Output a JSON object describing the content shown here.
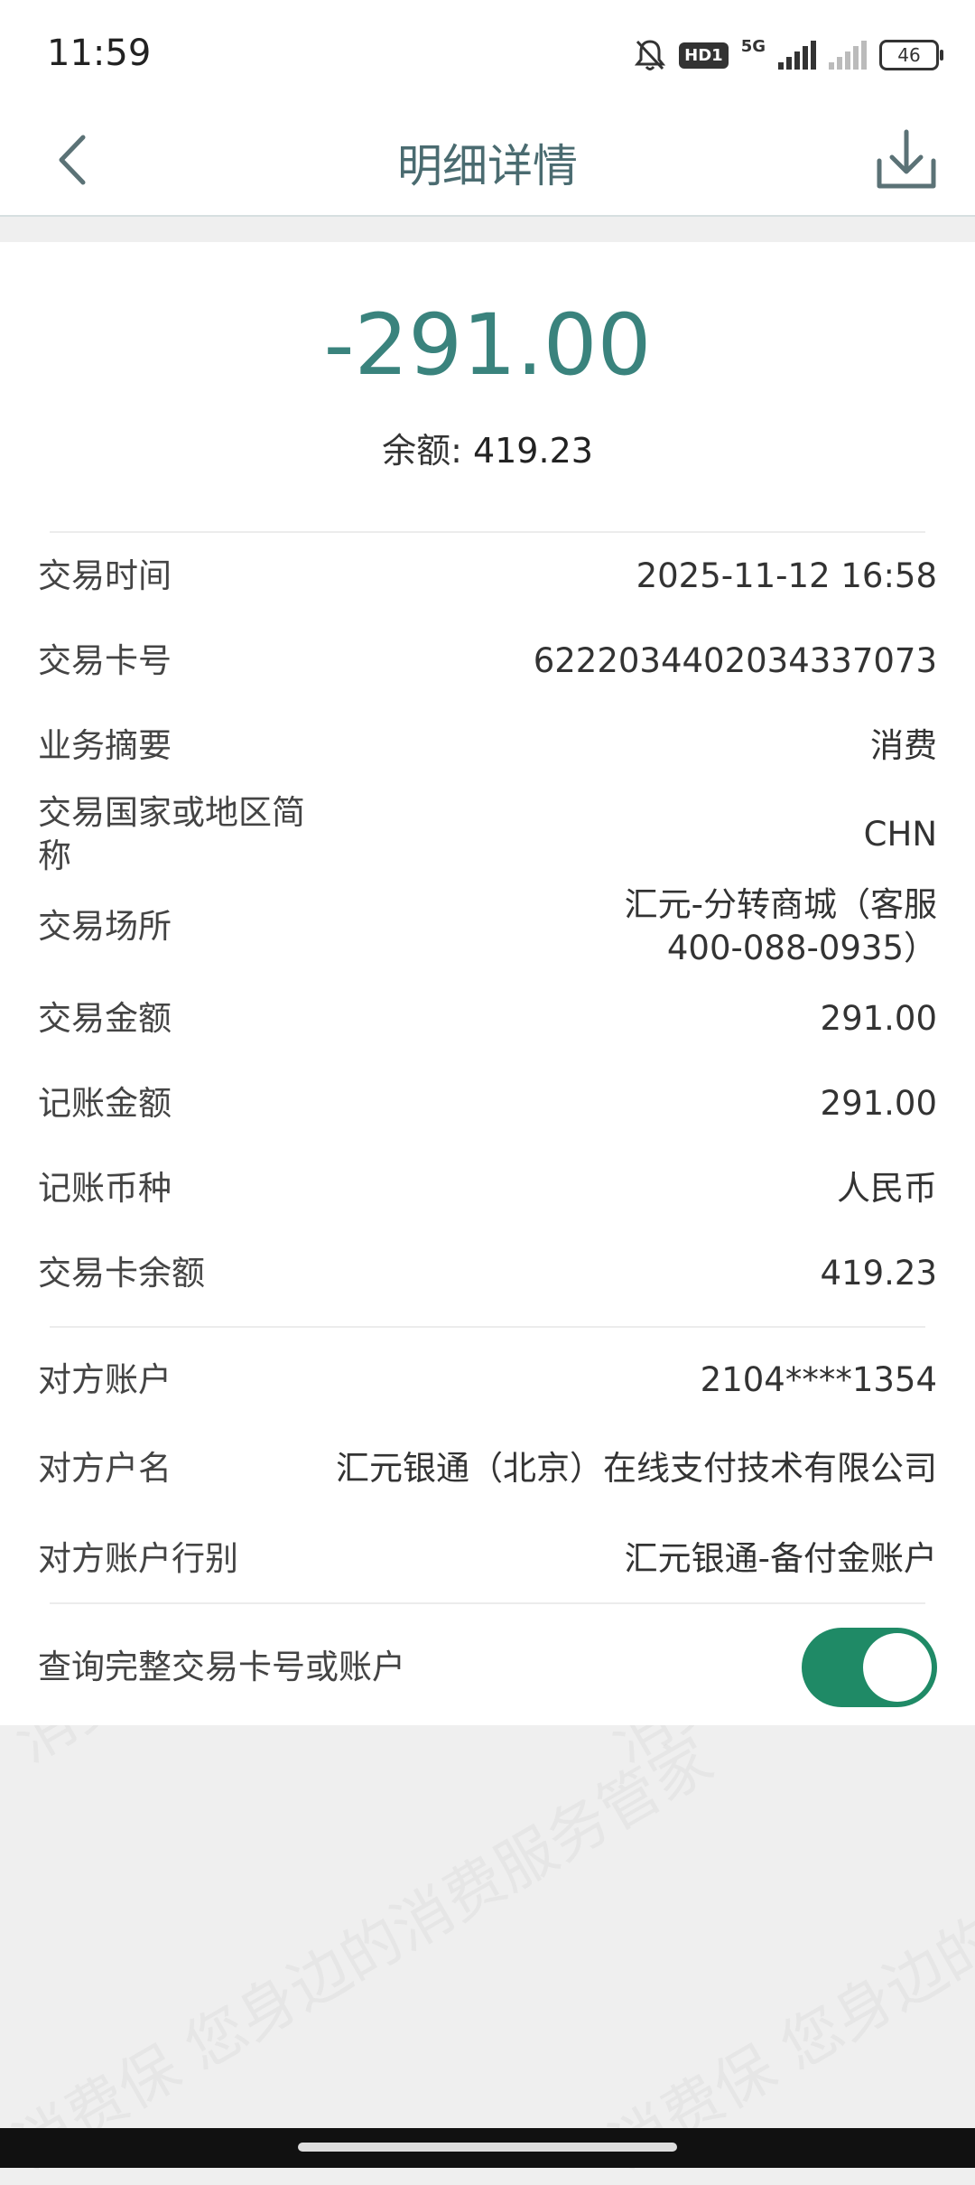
{
  "status_bar": {
    "time": "11:59",
    "network_label": "5G",
    "hd_badge": "HD1",
    "battery": "46",
    "icons": [
      "bell-muted-icon",
      "signal-icon",
      "signal-weak-icon",
      "battery-icon"
    ]
  },
  "header": {
    "title": "明细详情",
    "icons": [
      "back-arrow-icon",
      "download-icon"
    ]
  },
  "summary": {
    "amount": "-291.00",
    "balance_label": "余额: ",
    "balance_value": "419.23",
    "amount_color": "#3a837d"
  },
  "details": [
    {
      "label": "交易时间",
      "value": "2025-11-12 16:58"
    },
    {
      "label": "交易卡号",
      "value": "6222034402034337073"
    },
    {
      "label": "业务摘要",
      "value": "消费"
    },
    {
      "label": "交易国家或地区简称",
      "value": "CHN"
    },
    {
      "label": "交易场所",
      "value": "汇元-分转商城（客服400-088-0935）"
    },
    {
      "label": "交易金额",
      "value": "291.00"
    },
    {
      "label": "记账金额",
      "value": "291.00"
    },
    {
      "label": "记账币种",
      "value": "人民币"
    },
    {
      "label": "交易卡余额",
      "value": "419.23"
    }
  ],
  "counterparty": [
    {
      "label": "对方账户",
      "value": "2104****1354"
    },
    {
      "label": "对方户名",
      "value": "汇元银通（北京）在线支付技术有限公司"
    },
    {
      "label": "对方账户行别",
      "value": "汇元银通-备付金账户"
    }
  ],
  "toggle": {
    "label": "查询完整交易卡号或账户",
    "on": true,
    "color": "#1f8a66"
  },
  "watermark": "消费保 您身边的消费服务管家"
}
